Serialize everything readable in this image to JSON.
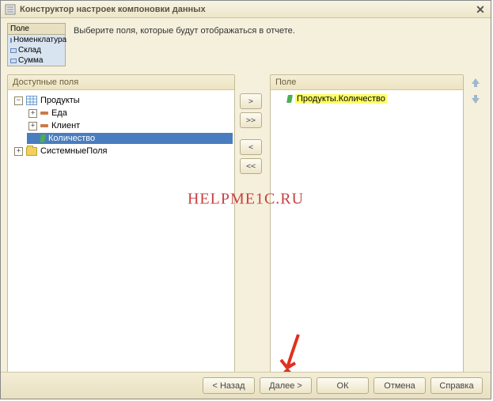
{
  "title": "Конструктор настроек компоновки данных",
  "hint": "Выберите поля, которые будут отображаться в отчете.",
  "step_box": {
    "header": "Поле",
    "items": [
      "Номенклатура",
      "Склад",
      "Сумма"
    ]
  },
  "left_panel": {
    "header": "Доступные поля",
    "tree": {
      "products": "Продукты",
      "food": "Еда",
      "client": "Клиент",
      "quantity": "Количество",
      "system_fields": "СистемныеПоля"
    }
  },
  "move_buttons": {
    "add": ">",
    "add_all": ">>",
    "remove": "<",
    "remove_all": "<<"
  },
  "right_panel": {
    "header": "Поле",
    "items": [
      "Продукты.Количество"
    ]
  },
  "buttons": {
    "back": "< Назад",
    "next": "Далее >",
    "ok": "ОК",
    "cancel": "Отмена",
    "help": "Справка"
  },
  "watermark": "HELPME1C.RU"
}
